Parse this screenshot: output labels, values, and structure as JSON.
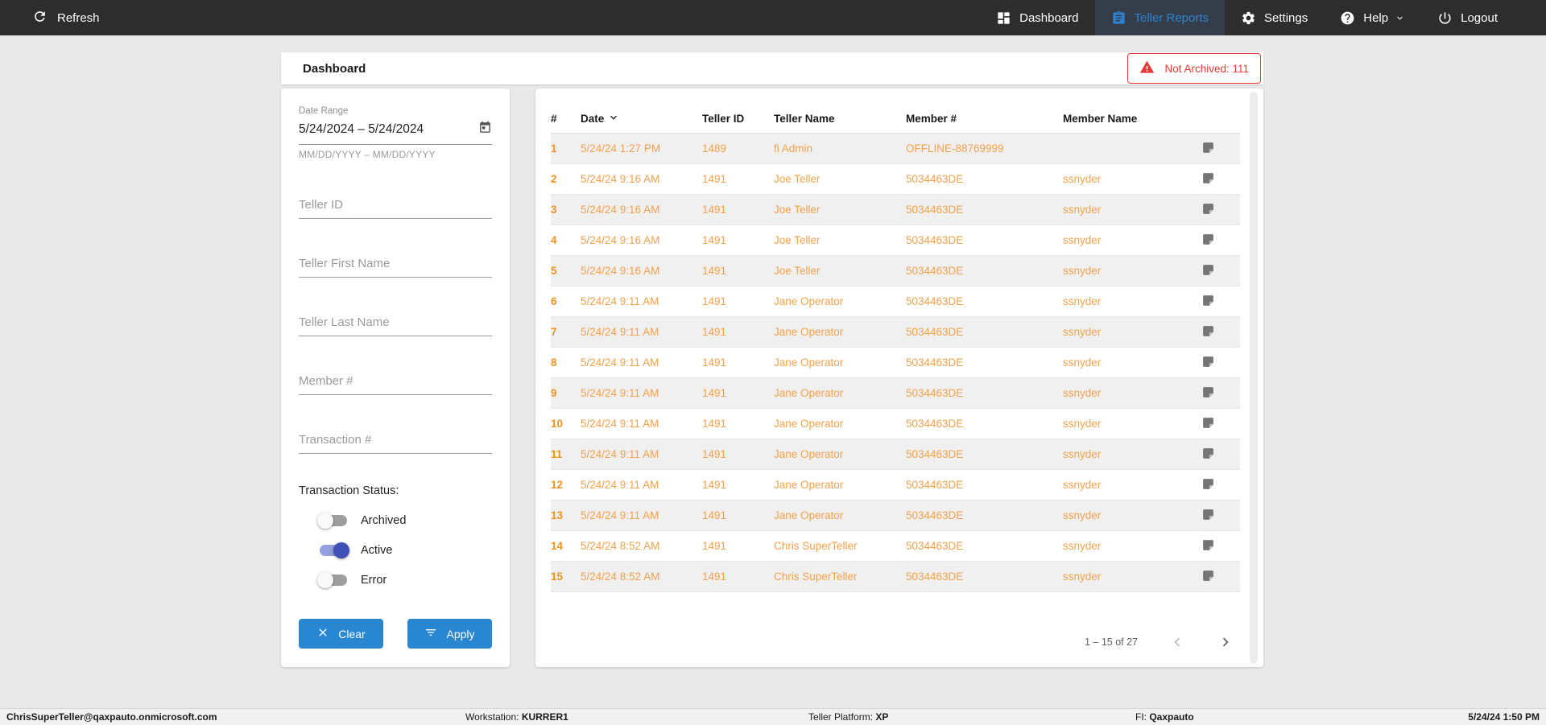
{
  "topnav": {
    "refresh_label": "Refresh",
    "items": [
      {
        "label": "Dashboard",
        "icon": "dashboard-icon",
        "active": false,
        "chevron": false
      },
      {
        "label": "Teller Reports",
        "icon": "clipboard-icon",
        "active": true,
        "chevron": false
      },
      {
        "label": "Settings",
        "icon": "gear-icon",
        "active": false,
        "chevron": false
      },
      {
        "label": "Help",
        "icon": "help-icon",
        "active": false,
        "chevron": true
      },
      {
        "label": "Logout",
        "icon": "power-icon",
        "active": false,
        "chevron": false
      }
    ]
  },
  "header": {
    "title": "Dashboard",
    "badge_label": "Not Archived: 111"
  },
  "filters": {
    "date_range": {
      "label": "Date Range",
      "value": "5/24/2024 – 5/24/2024",
      "helper": "MM/DD/YYYY – MM/DD/YYYY"
    },
    "inputs": [
      {
        "name": "teller-id-input",
        "placeholder": "Teller ID"
      },
      {
        "name": "teller-first-name-input",
        "placeholder": "Teller First Name"
      },
      {
        "name": "teller-last-name-input",
        "placeholder": "Teller Last Name"
      },
      {
        "name": "member-number-input",
        "placeholder": "Member #"
      },
      {
        "name": "transaction-number-input",
        "placeholder": "Transaction #"
      }
    ],
    "status": {
      "label": "Transaction Status:",
      "toggles": [
        {
          "label": "Archived",
          "on": false
        },
        {
          "label": "Active",
          "on": true
        },
        {
          "label": "Error",
          "on": false
        }
      ]
    },
    "clear_label": "Clear",
    "apply_label": "Apply"
  },
  "table": {
    "columns": [
      "#",
      "Date",
      "Teller ID",
      "Teller Name",
      "Member #",
      "Member Name"
    ],
    "sorted_column": "Date",
    "rows": [
      {
        "num": "1",
        "date": "5/24/24 1:27 PM",
        "teller_id": "1489",
        "teller_name": "fi Admin",
        "member_num": "OFFLINE-88769999",
        "member_name": ""
      },
      {
        "num": "2",
        "date": "5/24/24 9:16 AM",
        "teller_id": "1491",
        "teller_name": "Joe Teller",
        "member_num": "5034463DE",
        "member_name": "ssnyder"
      },
      {
        "num": "3",
        "date": "5/24/24 9:16 AM",
        "teller_id": "1491",
        "teller_name": "Joe Teller",
        "member_num": "5034463DE",
        "member_name": "ssnyder"
      },
      {
        "num": "4",
        "date": "5/24/24 9:16 AM",
        "teller_id": "1491",
        "teller_name": "Joe Teller",
        "member_num": "5034463DE",
        "member_name": "ssnyder"
      },
      {
        "num": "5",
        "date": "5/24/24 9:16 AM",
        "teller_id": "1491",
        "teller_name": "Joe Teller",
        "member_num": "5034463DE",
        "member_name": "ssnyder"
      },
      {
        "num": "6",
        "date": "5/24/24 9:11 AM",
        "teller_id": "1491",
        "teller_name": "Jane Operator",
        "member_num": "5034463DE",
        "member_name": "ssnyder"
      },
      {
        "num": "7",
        "date": "5/24/24 9:11 AM",
        "teller_id": "1491",
        "teller_name": "Jane Operator",
        "member_num": "5034463DE",
        "member_name": "ssnyder"
      },
      {
        "num": "8",
        "date": "5/24/24 9:11 AM",
        "teller_id": "1491",
        "teller_name": "Jane Operator",
        "member_num": "5034463DE",
        "member_name": "ssnyder"
      },
      {
        "num": "9",
        "date": "5/24/24 9:11 AM",
        "teller_id": "1491",
        "teller_name": "Jane Operator",
        "member_num": "5034463DE",
        "member_name": "ssnyder"
      },
      {
        "num": "10",
        "date": "5/24/24 9:11 AM",
        "teller_id": "1491",
        "teller_name": "Jane Operator",
        "member_num": "5034463DE",
        "member_name": "ssnyder"
      },
      {
        "num": "11",
        "date": "5/24/24 9:11 AM",
        "teller_id": "1491",
        "teller_name": "Jane Operator",
        "member_num": "5034463DE",
        "member_name": "ssnyder"
      },
      {
        "num": "12",
        "date": "5/24/24 9:11 AM",
        "teller_id": "1491",
        "teller_name": "Jane Operator",
        "member_num": "5034463DE",
        "member_name": "ssnyder"
      },
      {
        "num": "13",
        "date": "5/24/24 9:11 AM",
        "teller_id": "1491",
        "teller_name": "Jane Operator",
        "member_num": "5034463DE",
        "member_name": "ssnyder"
      },
      {
        "num": "14",
        "date": "5/24/24 8:52 AM",
        "teller_id": "1491",
        "teller_name": "Chris SuperTeller",
        "member_num": "5034463DE",
        "member_name": "ssnyder"
      },
      {
        "num": "15",
        "date": "5/24/24 8:52 AM",
        "teller_id": "1491",
        "teller_name": "Chris SuperTeller",
        "member_num": "5034463DE",
        "member_name": "ssnyder"
      }
    ],
    "pagination_label": "1 – 15 of 27"
  },
  "statusbar": {
    "user": "ChrisSuperTeller@qaxpauto.onmicrosoft.com",
    "workstation_label": "Workstation: ",
    "workstation": "KURRER1",
    "platform_label": "Teller Platform: ",
    "platform": "XP",
    "fi_label": "FI: ",
    "fi": "Qaxpauto",
    "time": "5/24/24 1:50 PM"
  },
  "colors": {
    "nav_bg": "#2d2d2d",
    "nav_active_link": "#2d83d2",
    "accent_blue": "#2986d1",
    "toggle_on": "#3f51b5",
    "error_red": "#e53935",
    "row_orange": "#f2a14c",
    "row_num_orange": "#ee9322"
  }
}
